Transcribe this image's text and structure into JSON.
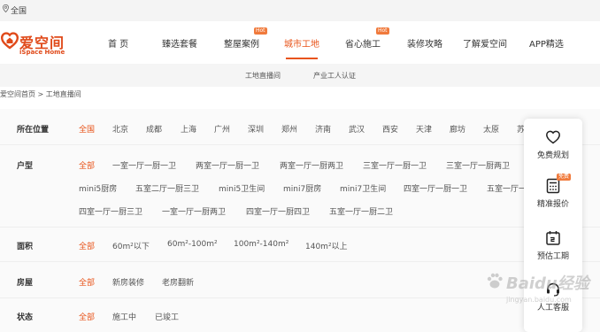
{
  "topbar": {
    "city": "全国"
  },
  "brand": {
    "name": "爱空间",
    "en": "iSpace Home",
    "color": "#e04a1a"
  },
  "nav": {
    "items": [
      {
        "label": "首 页"
      },
      {
        "label": "臻选套餐"
      },
      {
        "label": "整屋案例",
        "badge": "Hot"
      },
      {
        "label": "城市工地",
        "active": true
      },
      {
        "label": "省心施工",
        "badge": "Hot"
      },
      {
        "label": "装修攻略"
      },
      {
        "label": "了解爱空间"
      },
      {
        "label": "APP精选"
      }
    ],
    "accent": "#e8541a"
  },
  "subnav": {
    "items": [
      "工地直播间",
      "产业工人认证"
    ]
  },
  "breadcrumb": {
    "home": "爱空间首页",
    "separator": ">",
    "current": "工地直播间"
  },
  "filters": {
    "location": {
      "label": "所在位置",
      "options": [
        "全国",
        "北京",
        "成都",
        "上海",
        "广州",
        "深圳",
        "郑州",
        "济南",
        "武汉",
        "西安",
        "天津",
        "廊坊",
        "太原",
        "苏"
      ]
    },
    "layout": {
      "label": "户型",
      "options": [
        "全部",
        "一室一厅一厨一卫",
        "两室一厅一厨一卫",
        "两室一厅一厨两卫",
        "三室一厅一厨一卫",
        "三室一厅一厨两卫",
        "mini5厨房",
        "五室二厅一厨三卫",
        "mini5卫生间",
        "mini7厨房",
        "mini7卫生间",
        "四室一厅一厨一卫",
        "五室一厅一",
        "四室一厅一厨三卫",
        "一室一厅一厨两卫",
        "四室一厅一厨四卫",
        "五室一厅一厨二卫"
      ]
    },
    "area": {
      "label": "面积",
      "options": [
        "全部",
        "60m²以下",
        "60m²-100m²",
        "100m²-140m²",
        "140m²以上"
      ]
    },
    "house": {
      "label": "房屋",
      "options": [
        "全部",
        "新房装修",
        "老房翻新"
      ]
    },
    "status": {
      "label": "状态",
      "options": [
        "全部",
        "施工中",
        "已竣工"
      ]
    }
  },
  "float_panel": {
    "items": [
      {
        "label": "免费规划",
        "icon": "heart-icon"
      },
      {
        "label": "精准报价",
        "icon": "calculator-icon",
        "badge": "免费"
      },
      {
        "label": "预估工期",
        "icon": "calendar-icon"
      },
      {
        "label": "人工客服",
        "icon": "service-icon"
      }
    ]
  },
  "watermark": {
    "text": "Baidu经验",
    "sub": "jingyan.baidu.com"
  }
}
